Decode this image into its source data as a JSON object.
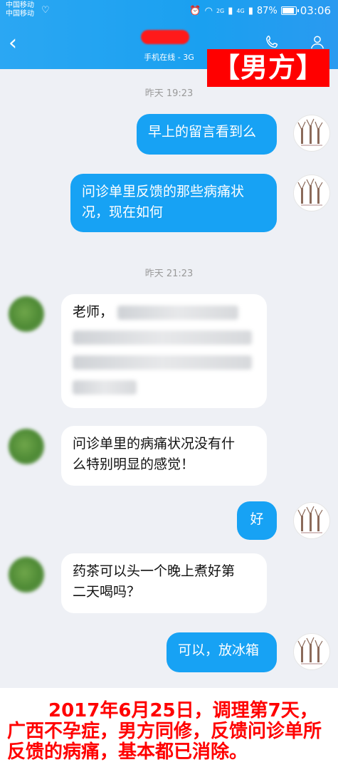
{
  "status_bar": {
    "carrier_1": "中国移动",
    "carrier_2": "中国移动",
    "network_1": "2G",
    "network_2": "4G",
    "battery": "87%",
    "battery_level": 0.87,
    "time": "03:06"
  },
  "header": {
    "online_status": "手机在线 - 3G",
    "icons": [
      "back-arrow-icon",
      "phone-icon",
      "person-icon"
    ]
  },
  "tag": "【男方】",
  "messages": [
    {
      "type": "time",
      "text": "昨天 19:23"
    },
    {
      "type": "out",
      "lines": [
        "早上的留言看到么"
      ]
    },
    {
      "type": "out",
      "lines": [
        "问诊单里反馈的那些病痛状",
        "况，现在如何"
      ]
    },
    {
      "type": "time",
      "text": "昨天 21:23"
    },
    {
      "type": "in",
      "lines": [
        "老师，"
      ]
    },
    {
      "type": "in",
      "lines": [
        "问诊单里的病痛状况没有什",
        "么特别明显的感觉！"
      ]
    },
    {
      "type": "out",
      "lines": [
        "好"
      ]
    },
    {
      "type": "in",
      "lines": [
        "药茶可以头一个晚上煮好第",
        "二天喝吗？"
      ]
    },
    {
      "type": "out",
      "lines": [
        "可以，放冰箱"
      ]
    }
  ],
  "caption": "2017年6月25日，调理第7天，广西不孕症，男方同修，反馈问诊单所反馈的病痛，基本都已消除。",
  "colors": {
    "header_blue": "#1aa0f0",
    "bubble_out": "#17a2f4",
    "bubble_in": "#ffffff",
    "tag_red": "#ff0000",
    "caption_red": "#ff0000",
    "background": "#eef0f5"
  }
}
